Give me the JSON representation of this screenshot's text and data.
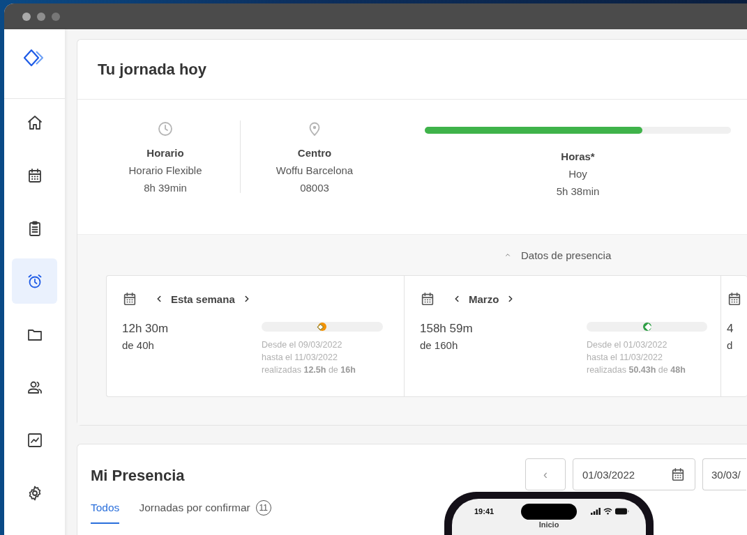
{
  "sidebar": {
    "items": [
      {
        "kind": "home",
        "selected": false
      },
      {
        "kind": "calendar",
        "selected": false
      },
      {
        "kind": "clipboard",
        "selected": false
      },
      {
        "kind": "alarm",
        "selected": true
      },
      {
        "kind": "folder",
        "selected": false
      },
      {
        "kind": "users",
        "selected": false
      },
      {
        "kind": "chart",
        "selected": false
      },
      {
        "kind": "settings",
        "selected": false
      }
    ]
  },
  "today": {
    "title": "Tu jornada hoy",
    "stats": [
      {
        "kind": "clock",
        "label": "Horario",
        "lines": [
          "Horario Flexible",
          "8h 39min"
        ]
      },
      {
        "kind": "pin",
        "label": "Centro",
        "lines": [
          "Woffu Barcelona",
          "08003"
        ]
      },
      {
        "kind": "progress",
        "label": "Horas*",
        "lines": [
          "Hoy",
          "5h 38min"
        ],
        "level": 0.71
      }
    ],
    "presence_toggle": {
      "label": "Datos de presencia",
      "expanded": true
    },
    "periods": [
      {
        "period": "Esta semana",
        "worked": "12h 30m",
        "target": "de 40h",
        "color": "#f39200",
        "kind": "under",
        "details": [
          "Desde el 09/03/2022",
          "hasta el 11/03/2022",
          "realizadas **12.5h** de **16h**"
        ]
      },
      {
        "period": "Marzo",
        "worked": "158h 59m",
        "target": "de 160h",
        "color": "#2e9e44",
        "kind": "over",
        "details": [
          "Desde el 01/03/2022",
          "hasta el 11/03/2022",
          "realizadas **50.43h** de **48h**"
        ]
      },
      {
        "worked": "4",
        "target": "d"
      }
    ]
  },
  "presence": {
    "title": "Mi Presencia",
    "tabs": [
      {
        "label": "Todos",
        "selected": true
      },
      {
        "label": "Jornadas por confirmar",
        "badge": "11",
        "selected": false
      }
    ],
    "prev_button": "‹",
    "date_from": "01/03/2022",
    "date_to": "30/03/"
  },
  "phone": {
    "time": "19:41",
    "title": "Inicio"
  }
}
